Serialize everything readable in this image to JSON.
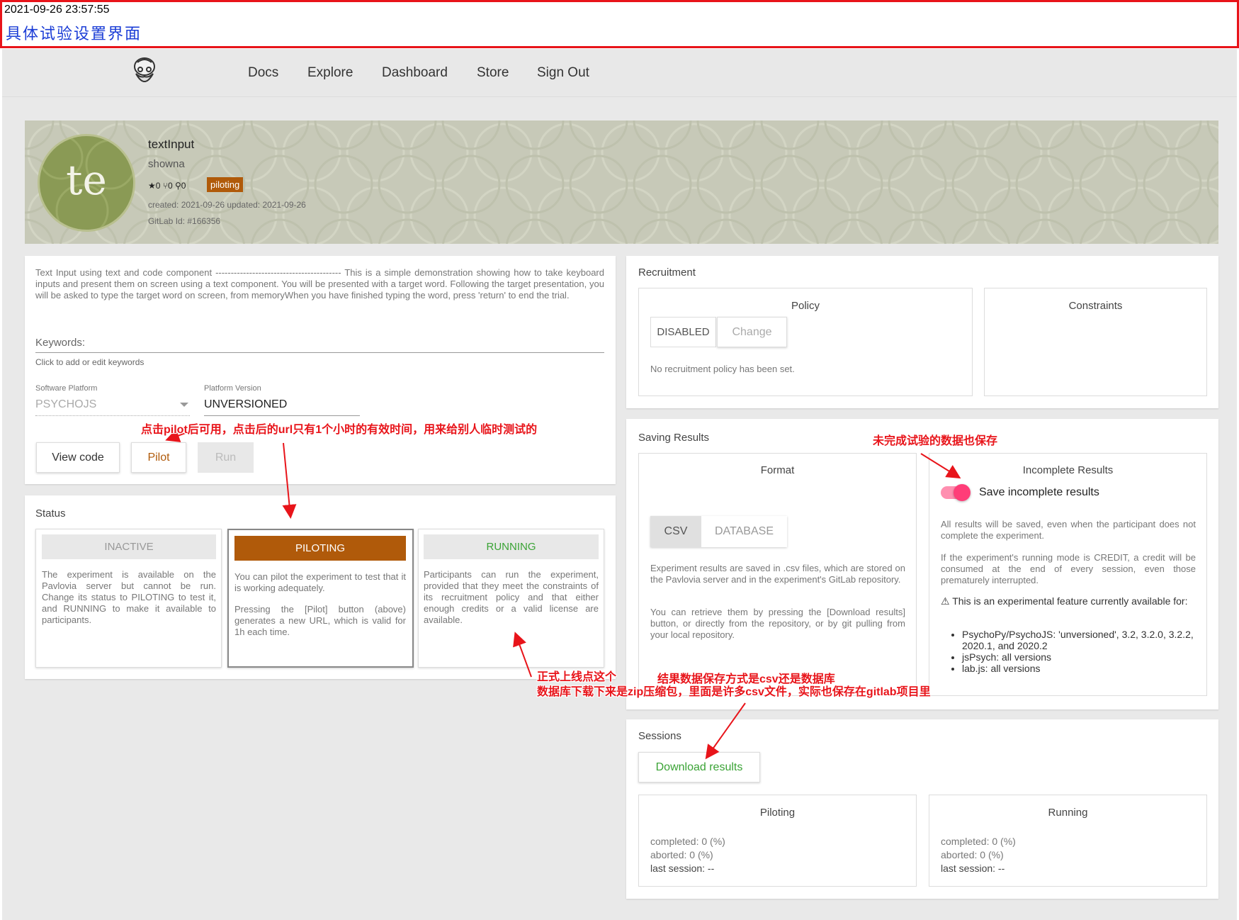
{
  "annotation_header": {
    "timestamp": "2021-09-26 23:57:55",
    "title": "具体试验设置界面"
  },
  "nav": {
    "items": [
      "Docs",
      "Explore",
      "Dashboard",
      "Store",
      "Sign Out"
    ]
  },
  "project": {
    "avatar_text": "te",
    "name": "textInput",
    "owner": "showna",
    "stats": "★0  ⑂0  ⚲0",
    "status_badge": "piloting",
    "dates": "created: 2021-09-26   updated: 2021-09-26",
    "gitlab_id": "GitLab Id: #166356"
  },
  "description": {
    "text": "Text Input using text and code component ----------------------------------------- This is a simple demonstration showing how to take keyboard inputs and present them on screen using a text component. You will be presented with a target word. Following the target presentation, you will be asked to type the target word on screen, from memoryWhen you have finished typing the word, press 'return' to end the trial.",
    "keywords_label": "Keywords:",
    "keywords_hint": "Click to add or edit keywords",
    "software_platform_label": "Software Platform",
    "software_platform_value": "PSYCHOJS",
    "platform_version_label": "Platform Version",
    "platform_version_value": "UNVERSIONED",
    "buttons": {
      "view_code": "View code",
      "pilot": "Pilot",
      "run": "Run"
    }
  },
  "status": {
    "title": "Status",
    "inactive": {
      "label": "INACTIVE",
      "text": "The experiment is available on the Pavlovia server but cannot be run. Change its status to PILOTING to test it, and RUNNING to make it available to participants."
    },
    "piloting": {
      "label": "PILOTING",
      "text1": "You can pilot the experiment to test that it is working adequately.",
      "text2": "Pressing the [Pilot] button (above) generates a new URL, which is valid for 1h each time."
    },
    "running": {
      "label": "RUNNING",
      "text": "Participants can run the experiment, provided that they meet the constraints of its recruitment policy and that either enough credits or a valid license are available."
    }
  },
  "recruitment": {
    "title": "Recruitment",
    "policy_title": "Policy",
    "policy_value": "DISABLED",
    "change_button": "Change",
    "policy_note": "No recruitment policy has been set.",
    "constraints_title": "Constraints"
  },
  "saving": {
    "title": "Saving Results",
    "format_title": "Format",
    "format_options": [
      "CSV",
      "DATABASE"
    ],
    "format_text1": "Experiment results are saved in .csv files, which are stored on the Pavlovia server and in the experiment's GitLab repository.",
    "format_text2": "You can retrieve them by pressing the [Download results] button, or directly from the repository, or by git pulling from your local repository.",
    "incomplete_title": "Incomplete Results",
    "toggle_label": "Save incomplete results",
    "incomplete_text1": "All results will be saved, even when the participant does not complete the experiment.",
    "incomplete_text2": "If the experiment's running mode is CREDIT, a credit will be consumed at the end of every session, even those prematurely interrupted.",
    "warning_text": "This is an experimental feature currently available for:",
    "support_list": [
      "PsychoPy/PsychoJS: 'unversioned', 3.2, 3.2.0, 3.2.2, 2020.1, and 2020.2",
      "jsPsych: all versions",
      "lab.js: all versions"
    ]
  },
  "sessions": {
    "title": "Sessions",
    "download_button": "Download results",
    "piloting": {
      "title": "Piloting",
      "completed": "completed: 0 (%)",
      "aborted": "aborted: 0 (%)",
      "last_session": "last session: --"
    },
    "running": {
      "title": "Running",
      "completed": "completed: 0 (%)",
      "aborted": "aborted: 0 (%)",
      "last_session": "last session: --"
    }
  },
  "annotations": {
    "pilot_note": "点击pilot后可用，点击后的url只有1个小时的有效时间，用来给别人临时测试的",
    "incomplete_note": "未完成试验的数据也保存",
    "running_note": "正式上线点这个",
    "format_note": "结果数据保存方式是csv还是数据库",
    "database_note": "数据库下载下来是zip压缩包，里面是许多csv文件，实际也保存在gitlab项目里"
  },
  "colors": {
    "accent_pink": "#ff3d78",
    "piloting_brown": "#b05a0a",
    "running_green": "#3aa335",
    "annotation_red": "#e8141a",
    "annotation_title_blue": "#1a3cd6"
  }
}
